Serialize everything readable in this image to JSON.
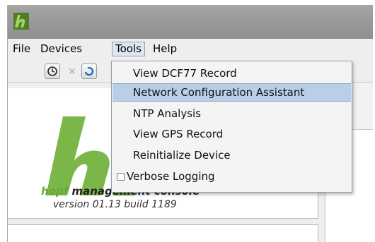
{
  "app": {
    "logo_letter": "h"
  },
  "menu": {
    "file": "File",
    "devices": "Devices",
    "tools": "Tools",
    "help": "Help"
  },
  "toolbar": {
    "buttons": [
      "clock-icon",
      "close-icon",
      "refresh-icon"
    ]
  },
  "branding": {
    "brand": "hopf",
    "product": "management console",
    "version": "version 01.13 build 1189"
  },
  "tools_menu": {
    "items": [
      {
        "label": "View DCF77 Record",
        "highlighted": false
      },
      {
        "label": "Network Configuration Assistant",
        "highlighted": true
      },
      {
        "label": "NTP Analysis",
        "highlighted": false
      },
      {
        "label": "View GPS Record",
        "highlighted": false
      },
      {
        "label": "Reinitialize Device",
        "highlighted": false
      },
      {
        "label": "Verbose Logging",
        "checkbox": true,
        "checked": false
      }
    ]
  },
  "colors": {
    "brand_green": "#6aa83a",
    "menu_highlight": "#b8cfe5",
    "titlebar": "#999999"
  }
}
